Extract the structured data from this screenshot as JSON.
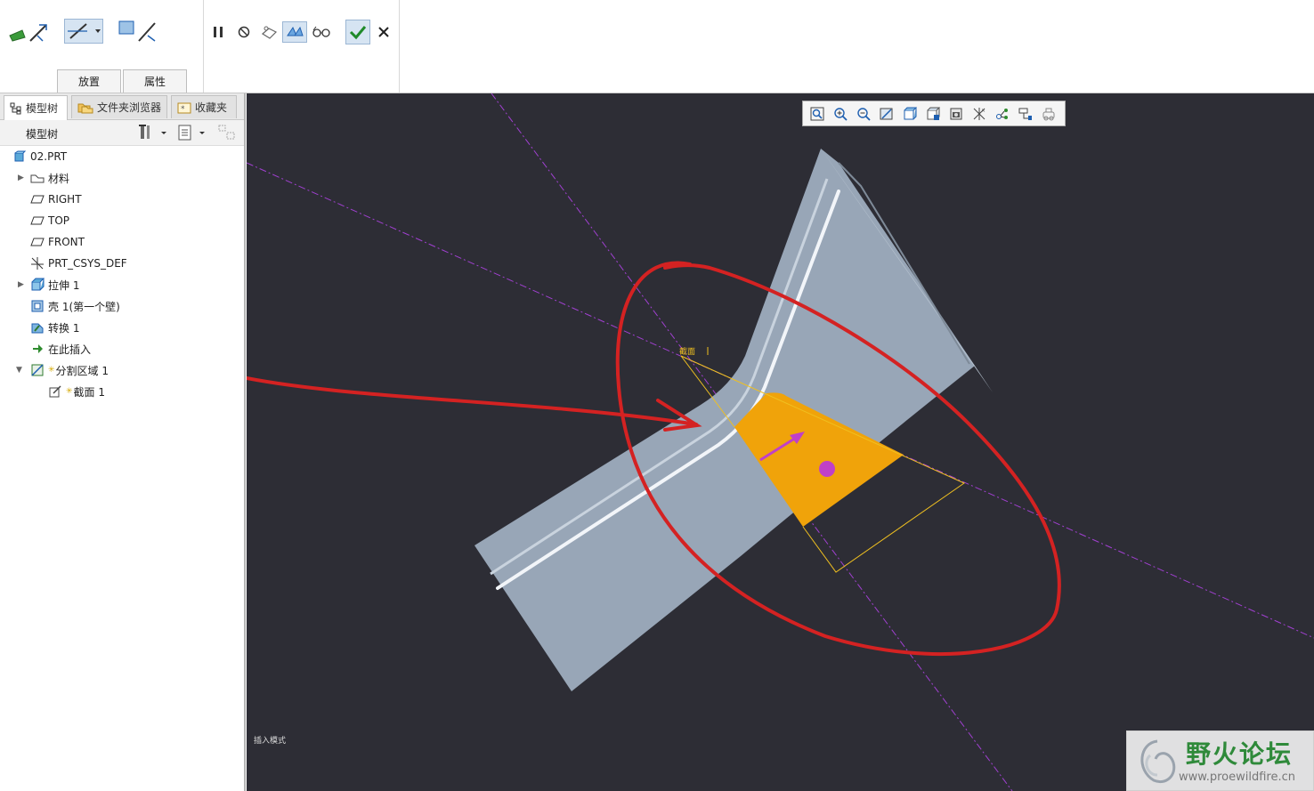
{
  "ribbon": {
    "tabs": [
      "放置",
      "属性"
    ]
  },
  "panel": {
    "tabs": [
      "模型树",
      "文件夹浏览器",
      "收藏夹"
    ],
    "tree_label": "模型树"
  },
  "tree": {
    "items": [
      {
        "label": "02.PRT",
        "icon": "part-icon"
      },
      {
        "label": "材料",
        "icon": "material-icon"
      },
      {
        "label": "RIGHT",
        "icon": "datum-plane-icon"
      },
      {
        "label": "TOP",
        "icon": "datum-plane-icon"
      },
      {
        "label": "FRONT",
        "icon": "datum-plane-icon"
      },
      {
        "label": "PRT_CSYS_DEF",
        "icon": "csys-icon"
      },
      {
        "label": "拉伸 1",
        "icon": "extrude-icon"
      },
      {
        "label": "壳 1(第一个壁)",
        "icon": "shell-icon"
      },
      {
        "label": "转换 1",
        "icon": "convert-icon"
      },
      {
        "label": "在此插入",
        "icon": "insert-here-icon"
      },
      {
        "label": "分割区域 1",
        "icon": "split-area-icon"
      },
      {
        "label": "截面 1",
        "icon": "sketch-icon"
      }
    ]
  },
  "viewport": {
    "section_label": "截面",
    "mode_text": "插入模式",
    "colors": {
      "background": "#2d2d35",
      "part": "#98a6b7",
      "section": "#f0a30a",
      "annotation": "#d42222",
      "datum": "#a040d0"
    }
  },
  "watermark": {
    "title": "野火论坛",
    "url": "www.proewildfire.cn"
  }
}
